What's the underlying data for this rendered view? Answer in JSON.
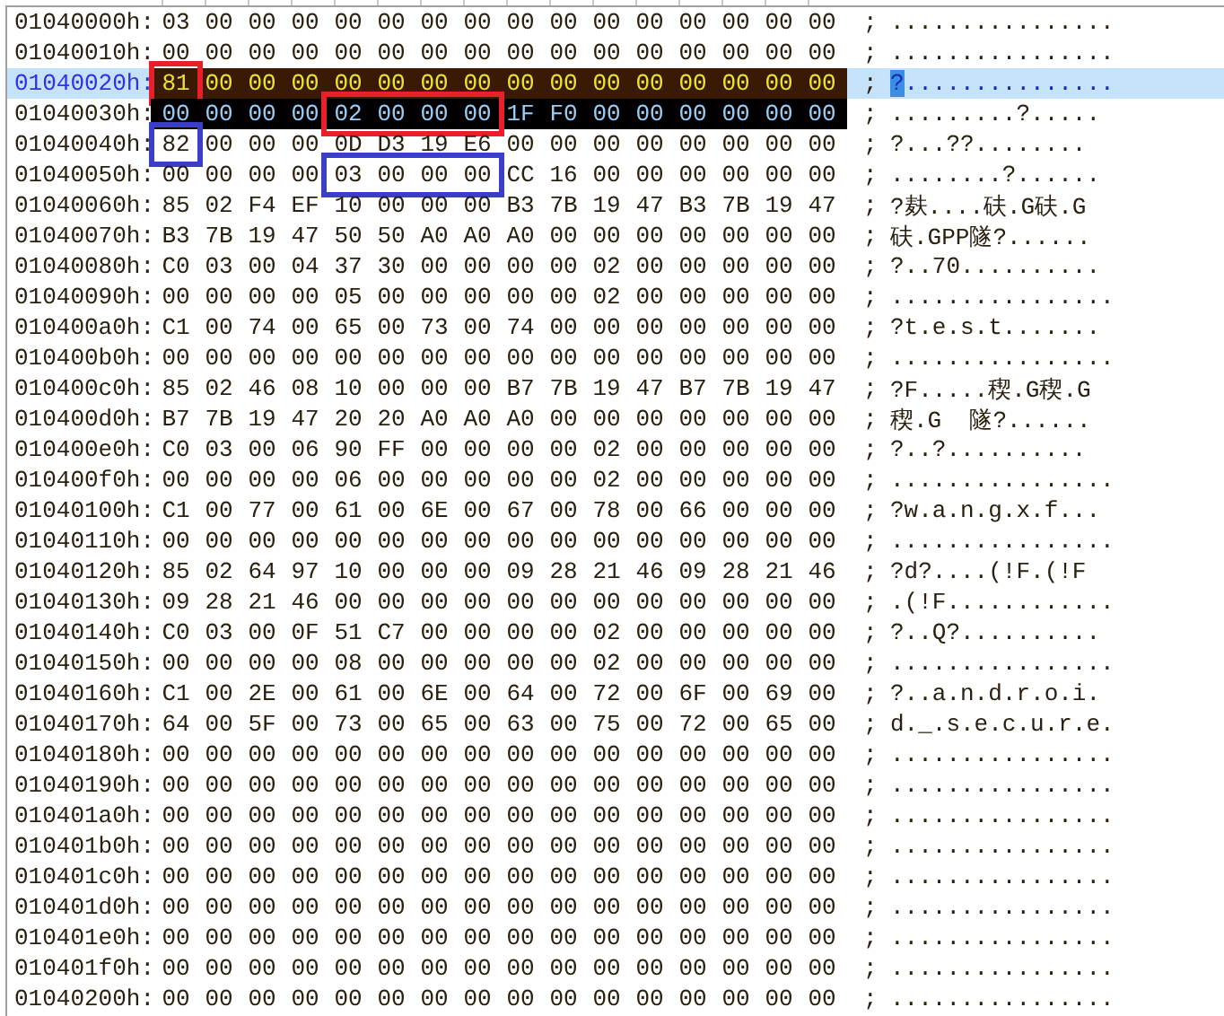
{
  "rows": [
    {
      "offset": "01040000h:",
      "current": false,
      "selected": false,
      "groups": [
        {
          "boxed": false,
          "bytes": [
            "03",
            "00",
            "00",
            "00",
            "00",
            "00",
            "00",
            "00",
            "00",
            "00",
            "00",
            "00",
            "00",
            "00",
            "00",
            "00"
          ]
        }
      ],
      "ascii": "................"
    },
    {
      "offset": "01040010h:",
      "current": false,
      "selected": false,
      "groups": [
        {
          "boxed": false,
          "bytes": [
            "00",
            "00",
            "00",
            "00",
            "00",
            "00",
            "00",
            "00",
            "00",
            "00",
            "00",
            "00",
            "00",
            "00",
            "00",
            "00"
          ]
        }
      ],
      "ascii": "................"
    },
    {
      "offset": "01040020h:",
      "current": true,
      "selected": true,
      "groups": [
        {
          "boxed": true,
          "color": "#e8202a",
          "bytes": [
            "81"
          ]
        },
        {
          "boxed": false,
          "bytes": [
            "00",
            "00",
            "00",
            "00",
            "00",
            "00",
            "00",
            "00",
            "00",
            "00",
            "00",
            "00",
            "00",
            "00",
            "00"
          ]
        }
      ],
      "ascii": "?..............."
    },
    {
      "offset": "01040030h:",
      "current": false,
      "selected": true,
      "groups": [
        {
          "boxed": false,
          "bytes": [
            "00",
            "00",
            "00",
            "00"
          ]
        },
        {
          "boxed": true,
          "color": "#e8202a",
          "bytes": [
            "02",
            "00",
            "00",
            "00"
          ]
        },
        {
          "boxed": false,
          "bytes": [
            "1F",
            "F0",
            "00",
            "00",
            "00",
            "00",
            "00",
            "00"
          ]
        }
      ],
      "ascii": ".........?....."
    },
    {
      "offset": "01040040h:",
      "current": false,
      "selected": false,
      "groups": [
        {
          "boxed": true,
          "color": "#3b3fc8",
          "bytes": [
            "82"
          ]
        },
        {
          "boxed": false,
          "bytes": [
            "00",
            "00",
            "00",
            "0D",
            "D3",
            "19",
            "E6",
            "00",
            "00",
            "00",
            "00",
            "00",
            "00",
            "00",
            "00"
          ]
        }
      ],
      "ascii": "?...??........"
    },
    {
      "offset": "01040050h:",
      "current": false,
      "selected": false,
      "groups": [
        {
          "boxed": false,
          "bytes": [
            "00",
            "00",
            "00",
            "00"
          ]
        },
        {
          "boxed": true,
          "color": "#3b3fc8",
          "bytes": [
            "03",
            "00",
            "00",
            "00"
          ]
        },
        {
          "boxed": false,
          "bytes": [
            "CC",
            "16",
            "00",
            "00",
            "00",
            "00",
            "00",
            "00"
          ]
        }
      ],
      "ascii": "........?......"
    },
    {
      "offset": "01040060h:",
      "current": false,
      "selected": false,
      "groups": [
        {
          "boxed": false,
          "bytes": [
            "85",
            "02",
            "F4",
            "EF",
            "10",
            "00",
            "00",
            "00",
            "B3",
            "7B",
            "19",
            "47",
            "B3",
            "7B",
            "19",
            "47"
          ]
        }
      ],
      "ascii": "?麸....砆.G砆.G"
    },
    {
      "offset": "01040070h:",
      "current": false,
      "selected": false,
      "groups": [
        {
          "boxed": false,
          "bytes": [
            "B3",
            "7B",
            "19",
            "47",
            "50",
            "50",
            "A0",
            "A0",
            "A0",
            "00",
            "00",
            "00",
            "00",
            "00",
            "00",
            "00"
          ]
        }
      ],
      "ascii": "砆.GPP隧?......"
    },
    {
      "offset": "01040080h:",
      "current": false,
      "selected": false,
      "groups": [
        {
          "boxed": false,
          "bytes": [
            "C0",
            "03",
            "00",
            "04",
            "37",
            "30",
            "00",
            "00",
            "00",
            "00",
            "02",
            "00",
            "00",
            "00",
            "00",
            "00"
          ]
        }
      ],
      "ascii": "?..70.........."
    },
    {
      "offset": "01040090h:",
      "current": false,
      "selected": false,
      "groups": [
        {
          "boxed": false,
          "bytes": [
            "00",
            "00",
            "00",
            "00",
            "05",
            "00",
            "00",
            "00",
            "00",
            "00",
            "02",
            "00",
            "00",
            "00",
            "00",
            "00"
          ]
        }
      ],
      "ascii": "................"
    },
    {
      "offset": "010400a0h:",
      "current": false,
      "selected": false,
      "groups": [
        {
          "boxed": false,
          "bytes": [
            "C1",
            "00",
            "74",
            "00",
            "65",
            "00",
            "73",
            "00",
            "74",
            "00",
            "00",
            "00",
            "00",
            "00",
            "00",
            "00"
          ]
        }
      ],
      "ascii": "?t.e.s.t......."
    },
    {
      "offset": "010400b0h:",
      "current": false,
      "selected": false,
      "groups": [
        {
          "boxed": false,
          "bytes": [
            "00",
            "00",
            "00",
            "00",
            "00",
            "00",
            "00",
            "00",
            "00",
            "00",
            "00",
            "00",
            "00",
            "00",
            "00",
            "00"
          ]
        }
      ],
      "ascii": "................"
    },
    {
      "offset": "010400c0h:",
      "current": false,
      "selected": false,
      "groups": [
        {
          "boxed": false,
          "bytes": [
            "85",
            "02",
            "46",
            "08",
            "10",
            "00",
            "00",
            "00",
            "B7",
            "7B",
            "19",
            "47",
            "B7",
            "7B",
            "19",
            "47"
          ]
        }
      ],
      "ascii": "?F.....稧.G稧.G"
    },
    {
      "offset": "010400d0h:",
      "current": false,
      "selected": false,
      "groups": [
        {
          "boxed": false,
          "bytes": [
            "B7",
            "7B",
            "19",
            "47",
            "20",
            "20",
            "A0",
            "A0",
            "A0",
            "00",
            "00",
            "00",
            "00",
            "00",
            "00",
            "00"
          ]
        }
      ],
      "ascii": "稧.G  隧?......"
    },
    {
      "offset": "010400e0h:",
      "current": false,
      "selected": false,
      "groups": [
        {
          "boxed": false,
          "bytes": [
            "C0",
            "03",
            "00",
            "06",
            "90",
            "FF",
            "00",
            "00",
            "00",
            "00",
            "02",
            "00",
            "00",
            "00",
            "00",
            "00"
          ]
        }
      ],
      "ascii": "?..?.........."
    },
    {
      "offset": "010400f0h:",
      "current": false,
      "selected": false,
      "groups": [
        {
          "boxed": false,
          "bytes": [
            "00",
            "00",
            "00",
            "00",
            "06",
            "00",
            "00",
            "00",
            "00",
            "00",
            "02",
            "00",
            "00",
            "00",
            "00",
            "00"
          ]
        }
      ],
      "ascii": "................"
    },
    {
      "offset": "01040100h:",
      "current": false,
      "selected": false,
      "groups": [
        {
          "boxed": false,
          "bytes": [
            "C1",
            "00",
            "77",
            "00",
            "61",
            "00",
            "6E",
            "00",
            "67",
            "00",
            "78",
            "00",
            "66",
            "00",
            "00",
            "00"
          ]
        }
      ],
      "ascii": "?w.a.n.g.x.f..."
    },
    {
      "offset": "01040110h:",
      "current": false,
      "selected": false,
      "groups": [
        {
          "boxed": false,
          "bytes": [
            "00",
            "00",
            "00",
            "00",
            "00",
            "00",
            "00",
            "00",
            "00",
            "00",
            "00",
            "00",
            "00",
            "00",
            "00",
            "00"
          ]
        }
      ],
      "ascii": "................"
    },
    {
      "offset": "01040120h:",
      "current": false,
      "selected": false,
      "groups": [
        {
          "boxed": false,
          "bytes": [
            "85",
            "02",
            "64",
            "97",
            "10",
            "00",
            "00",
            "00",
            "09",
            "28",
            "21",
            "46",
            "09",
            "28",
            "21",
            "46"
          ]
        }
      ],
      "ascii": "?d?....(!F.(!F"
    },
    {
      "offset": "01040130h:",
      "current": false,
      "selected": false,
      "groups": [
        {
          "boxed": false,
          "bytes": [
            "09",
            "28",
            "21",
            "46",
            "00",
            "00",
            "00",
            "00",
            "00",
            "00",
            "00",
            "00",
            "00",
            "00",
            "00",
            "00"
          ]
        }
      ],
      "ascii": ".(!F............"
    },
    {
      "offset": "01040140h:",
      "current": false,
      "selected": false,
      "groups": [
        {
          "boxed": false,
          "bytes": [
            "C0",
            "03",
            "00",
            "0F",
            "51",
            "C7",
            "00",
            "00",
            "00",
            "00",
            "02",
            "00",
            "00",
            "00",
            "00",
            "00"
          ]
        }
      ],
      "ascii": "?..Q?.........."
    },
    {
      "offset": "01040150h:",
      "current": false,
      "selected": false,
      "groups": [
        {
          "boxed": false,
          "bytes": [
            "00",
            "00",
            "00",
            "00",
            "08",
            "00",
            "00",
            "00",
            "00",
            "00",
            "02",
            "00",
            "00",
            "00",
            "00",
            "00"
          ]
        }
      ],
      "ascii": "................"
    },
    {
      "offset": "01040160h:",
      "current": false,
      "selected": false,
      "groups": [
        {
          "boxed": false,
          "bytes": [
            "C1",
            "00",
            "2E",
            "00",
            "61",
            "00",
            "6E",
            "00",
            "64",
            "00",
            "72",
            "00",
            "6F",
            "00",
            "69",
            "00"
          ]
        }
      ],
      "ascii": "?..a.n.d.r.o.i."
    },
    {
      "offset": "01040170h:",
      "current": false,
      "selected": false,
      "groups": [
        {
          "boxed": false,
          "bytes": [
            "64",
            "00",
            "5F",
            "00",
            "73",
            "00",
            "65",
            "00",
            "63",
            "00",
            "75",
            "00",
            "72",
            "00",
            "65",
            "00"
          ]
        }
      ],
      "ascii": "d._.s.e.c.u.r.e."
    },
    {
      "offset": "01040180h:",
      "current": false,
      "selected": false,
      "groups": [
        {
          "boxed": false,
          "bytes": [
            "00",
            "00",
            "00",
            "00",
            "00",
            "00",
            "00",
            "00",
            "00",
            "00",
            "00",
            "00",
            "00",
            "00",
            "00",
            "00"
          ]
        }
      ],
      "ascii": "................"
    },
    {
      "offset": "01040190h:",
      "current": false,
      "selected": false,
      "groups": [
        {
          "boxed": false,
          "bytes": [
            "00",
            "00",
            "00",
            "00",
            "00",
            "00",
            "00",
            "00",
            "00",
            "00",
            "00",
            "00",
            "00",
            "00",
            "00",
            "00"
          ]
        }
      ],
      "ascii": "................"
    },
    {
      "offset": "010401a0h:",
      "current": false,
      "selected": false,
      "groups": [
        {
          "boxed": false,
          "bytes": [
            "00",
            "00",
            "00",
            "00",
            "00",
            "00",
            "00",
            "00",
            "00",
            "00",
            "00",
            "00",
            "00",
            "00",
            "00",
            "00"
          ]
        }
      ],
      "ascii": "................"
    },
    {
      "offset": "010401b0h:",
      "current": false,
      "selected": false,
      "groups": [
        {
          "boxed": false,
          "bytes": [
            "00",
            "00",
            "00",
            "00",
            "00",
            "00",
            "00",
            "00",
            "00",
            "00",
            "00",
            "00",
            "00",
            "00",
            "00",
            "00"
          ]
        }
      ],
      "ascii": "................"
    },
    {
      "offset": "010401c0h:",
      "current": false,
      "selected": false,
      "groups": [
        {
          "boxed": false,
          "bytes": [
            "00",
            "00",
            "00",
            "00",
            "00",
            "00",
            "00",
            "00",
            "00",
            "00",
            "00",
            "00",
            "00",
            "00",
            "00",
            "00"
          ]
        }
      ],
      "ascii": "................"
    },
    {
      "offset": "010401d0h:",
      "current": false,
      "selected": false,
      "groups": [
        {
          "boxed": false,
          "bytes": [
            "00",
            "00",
            "00",
            "00",
            "00",
            "00",
            "00",
            "00",
            "00",
            "00",
            "00",
            "00",
            "00",
            "00",
            "00",
            "00"
          ]
        }
      ],
      "ascii": "................"
    },
    {
      "offset": "010401e0h:",
      "current": false,
      "selected": false,
      "groups": [
        {
          "boxed": false,
          "bytes": [
            "00",
            "00",
            "00",
            "00",
            "00",
            "00",
            "00",
            "00",
            "00",
            "00",
            "00",
            "00",
            "00",
            "00",
            "00",
            "00"
          ]
        }
      ],
      "ascii": "................"
    },
    {
      "offset": "010401f0h:",
      "current": false,
      "selected": false,
      "groups": [
        {
          "boxed": false,
          "bytes": [
            "00",
            "00",
            "00",
            "00",
            "00",
            "00",
            "00",
            "00",
            "00",
            "00",
            "00",
            "00",
            "00",
            "00",
            "00",
            "00"
          ]
        }
      ],
      "ascii": "................"
    },
    {
      "offset": "01040200h:",
      "current": false,
      "selected": false,
      "groups": [
        {
          "boxed": false,
          "bytes": [
            "00",
            "00",
            "00",
            "00",
            "00",
            "00",
            "00",
            "00",
            "00",
            "00",
            "00",
            "00",
            "00",
            "00",
            "00",
            "00"
          ]
        }
      ],
      "ascii": "................"
    }
  ],
  "separator": ";"
}
